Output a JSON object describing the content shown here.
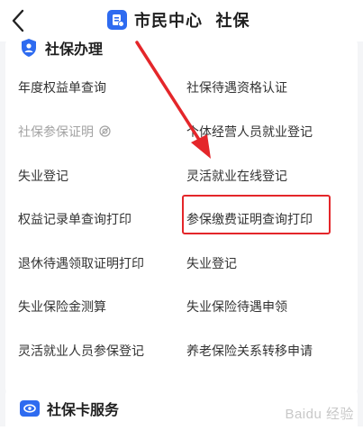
{
  "header": {
    "title": "市民中心  社保"
  },
  "section_social_security": {
    "title": "社保办理",
    "items": [
      {
        "label": "年度权益单查询"
      },
      {
        "label": "社保待遇资格认证"
      },
      {
        "label": "社保参保证明",
        "disabled": true
      },
      {
        "label": "个体经营人员就业登记"
      },
      {
        "label": "失业登记"
      },
      {
        "label": "灵活就业在线登记",
        "highlighted": true
      },
      {
        "label": "权益记录单查询打印"
      },
      {
        "label": "参保缴费证明查询打印"
      },
      {
        "label": "退休待遇领取证明打印"
      },
      {
        "label": "失业登记"
      },
      {
        "label": "失业保险金测算"
      },
      {
        "label": "失业保险待遇申领"
      },
      {
        "label": "灵活就业人员参保登记"
      },
      {
        "label": "养老保险关系转移申请"
      }
    ]
  },
  "section_card": {
    "title": "社保卡服务"
  },
  "annotation": {
    "color": "#e4262a"
  },
  "watermark": {
    "text": "Baidu 经验"
  },
  "colors": {
    "accent": "#2e6bf0",
    "text": "#333333",
    "disabled_text": "#a3a3a3",
    "background": "#f4f5f7"
  }
}
